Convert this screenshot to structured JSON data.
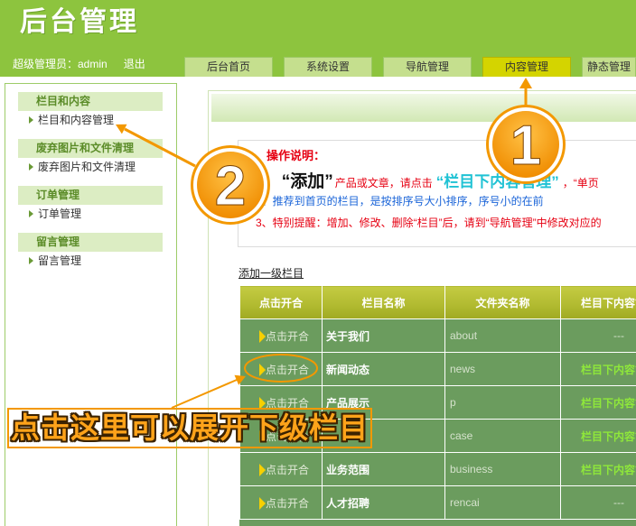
{
  "app": {
    "title": "后台管理"
  },
  "user_bar": {
    "user_label": "超级管理员：admin",
    "logout_label": "退出"
  },
  "tabs": [
    {
      "label": "后台首页",
      "active": false
    },
    {
      "label": "系统设置",
      "active": false
    },
    {
      "label": "导航管理",
      "active": false
    },
    {
      "label": "内容管理",
      "active": true
    },
    {
      "label": "静态管理",
      "active": false
    }
  ],
  "sidebar": {
    "sections": [
      {
        "title": "栏目和内容",
        "items": [
          "栏目和内容管理"
        ]
      },
      {
        "title": "废弃图片和文件清理",
        "items": [
          "废弃图片和文件清理"
        ]
      },
      {
        "title": "订单管理",
        "items": [
          "订单管理"
        ]
      },
      {
        "title": "留言管理",
        "items": [
          "留言管理"
        ]
      }
    ]
  },
  "instructions": {
    "heading": "操作说明：",
    "line1": {
      "number": "1、",
      "emphasis": "“添加”",
      "text": "产品或文章，请点击",
      "highlight": "“栏目下内容管理”",
      "tail": "，“单页"
    },
    "line2": "2、推荐到首页的栏目，是按排序号大小排序，序号小的在前",
    "line3": "3、特别提醒：增加、修改、删除“栏目”后，请到“导航管理”中修改对应的"
  },
  "add_top_level_link": "添加一级栏目",
  "table": {
    "headers": [
      "点击开合",
      "栏目名称",
      "文件夹名称",
      "栏目下内容管理"
    ],
    "rows": [
      {
        "toggle": "点击开合",
        "name": "关于我们",
        "folder": "about",
        "action": "---"
      },
      {
        "toggle": "点击开合",
        "name": "新闻动态",
        "folder": "news",
        "action": "栏目下内容管理"
      },
      {
        "toggle": "点击开合",
        "name": "产品展示",
        "folder": "p",
        "action": "栏目下内容管理"
      },
      {
        "toggle": "点击开合",
        "name": "",
        "folder": "case",
        "action": "栏目下内容管理"
      },
      {
        "toggle": "点击开合",
        "name": "业务范围",
        "folder": "business",
        "action": "栏目下内容管理"
      },
      {
        "toggle": "点击开合",
        "name": "人才招聘",
        "folder": "rencai",
        "action": "---"
      }
    ]
  },
  "annotations": {
    "step1_number": "1",
    "step2_number": "2",
    "banner_text": "点击这里可以展开下级栏目"
  },
  "icons": {
    "expand_toggle": "triangle-right-icon",
    "sidebar_bullet": "triangle-right-icon"
  },
  "colors": {
    "header": "#8dc43e",
    "tab": "#c5df8e",
    "tab_active": "#d4d400",
    "table_header": "#b2bb31",
    "table_row": "#6b9c5e",
    "action_link": "#8fe83a",
    "instruction_red": "#e60012",
    "instruction_blue": "#1a64d8",
    "highlight_cyan": "#1fc2d4",
    "annotation_orange": "#f39800",
    "sidebar_section_bg": "#dcedc3"
  }
}
